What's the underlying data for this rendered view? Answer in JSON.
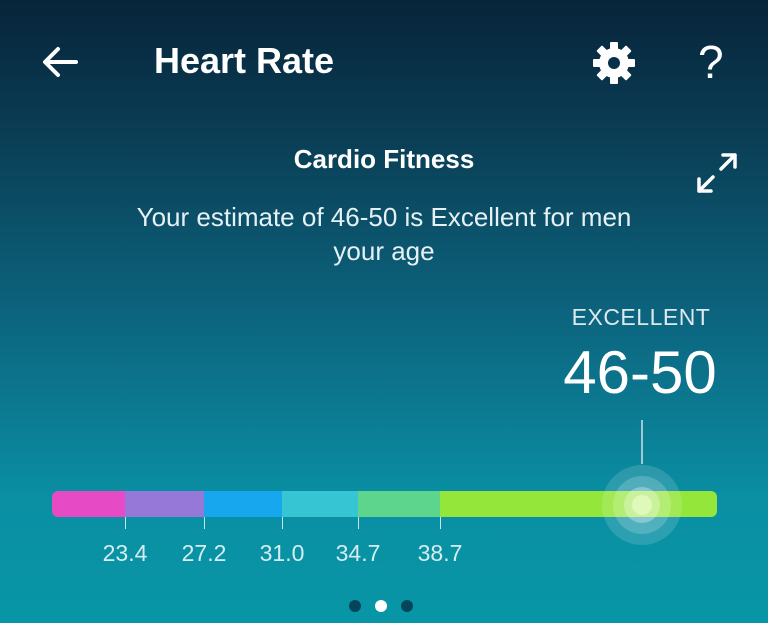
{
  "header": {
    "title": "Heart Rate",
    "back_icon": "arrow-left-icon",
    "settings_icon": "gear-icon",
    "help_label": "?"
  },
  "card": {
    "title": "Cardio Fitness",
    "description": "Your estimate of 46-50 is Excellent for men your age",
    "expand_icon": "expand-icon"
  },
  "score": {
    "level": "EXCELLENT",
    "value": "46-50"
  },
  "scale": {
    "ticks": [
      "23.4",
      "27.2",
      "31.0",
      "34.7",
      "38.7"
    ],
    "segment_colors": [
      "#e64ac4",
      "#9578d8",
      "#17a7ef",
      "#36c6d3",
      "#5ed58d",
      "#94e63a"
    ]
  },
  "pager": {
    "count": 3,
    "active_index": 1
  }
}
